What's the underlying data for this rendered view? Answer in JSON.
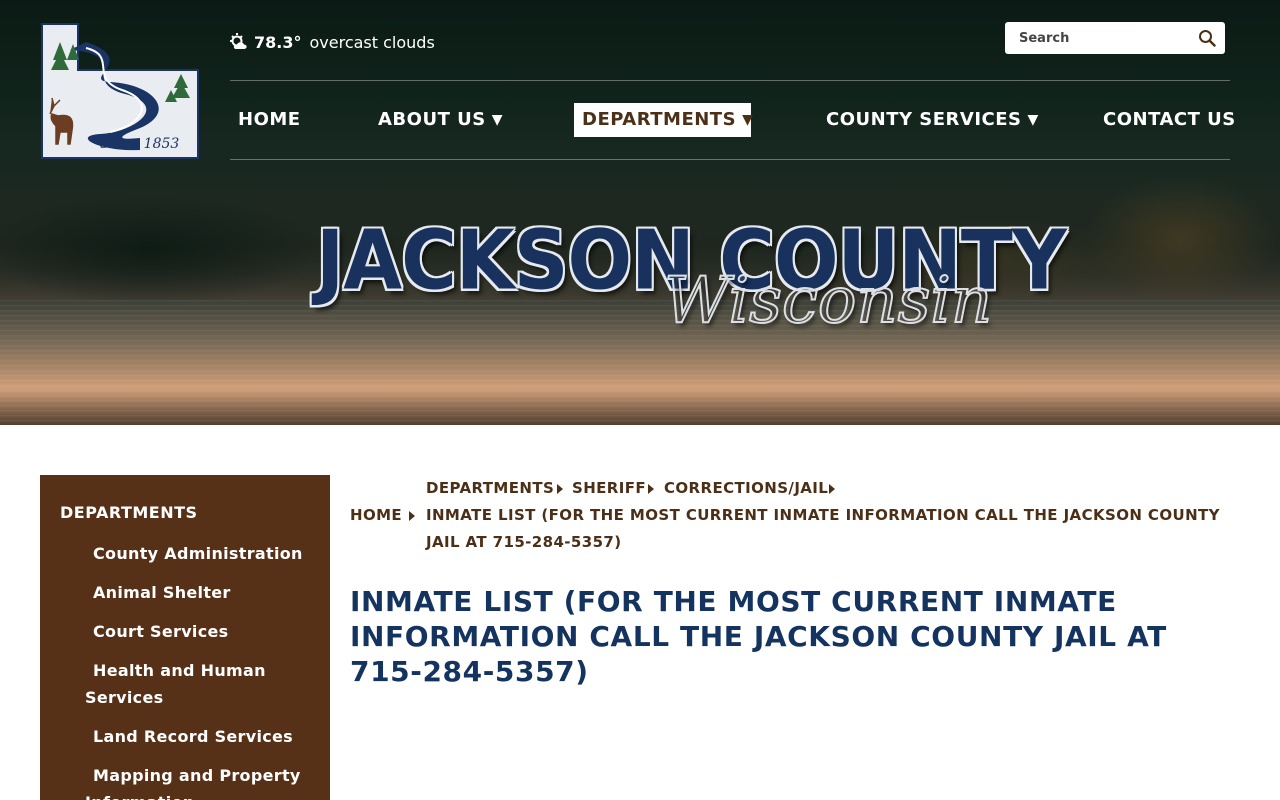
{
  "header": {
    "logo": {
      "caption": "Since 1853"
    },
    "weather": {
      "temperature": "78.3°",
      "condition": "overcast clouds"
    },
    "search": {
      "placeholder": "Search"
    },
    "nav": [
      {
        "label": "HOME",
        "has_dropdown": false,
        "active": false
      },
      {
        "label": "ABOUT US",
        "has_dropdown": true,
        "active": false
      },
      {
        "label": "DEPARTMENTS",
        "has_dropdown": true,
        "active": true
      },
      {
        "label": "COUNTY SERVICES",
        "has_dropdown": true,
        "active": false
      },
      {
        "label": "CONTACT US",
        "has_dropdown": false,
        "active": false
      }
    ],
    "dropdown_glyph": "▼",
    "brand": {
      "main": "JACKSON COUNTY",
      "script": "Wisconsin"
    }
  },
  "sidebar": {
    "title": "DEPARTMENTS",
    "items": [
      {
        "label": "County Administration"
      },
      {
        "label": "Animal Shelter"
      },
      {
        "label": "Court Services"
      },
      {
        "label": "Health and Human Services"
      },
      {
        "label": "Land Record Services"
      },
      {
        "label": "Mapping and Property Information"
      }
    ]
  },
  "breadcrumb": {
    "home": "HOME",
    "departments": "DEPARTMENTS",
    "sheriff": "SHERIFF",
    "jail": "CORRECTIONS/JAIL",
    "current": "INMATE LIST (FOR THE MOST CURRENT INMATE INFORMATION CALL THE JACKSON COUNTY JAIL AT 715-284-5357)"
  },
  "page": {
    "title": "INMATE LIST (FOR THE MOST CURRENT INMATE INFORMATION CALL THE JACKSON COUNTY JAIL AT 715-284-5357)"
  },
  "colors": {
    "sidebar_bg": "#573018",
    "brand_navy": "#14335f",
    "breadcrumb_brown": "#4b2f17"
  }
}
